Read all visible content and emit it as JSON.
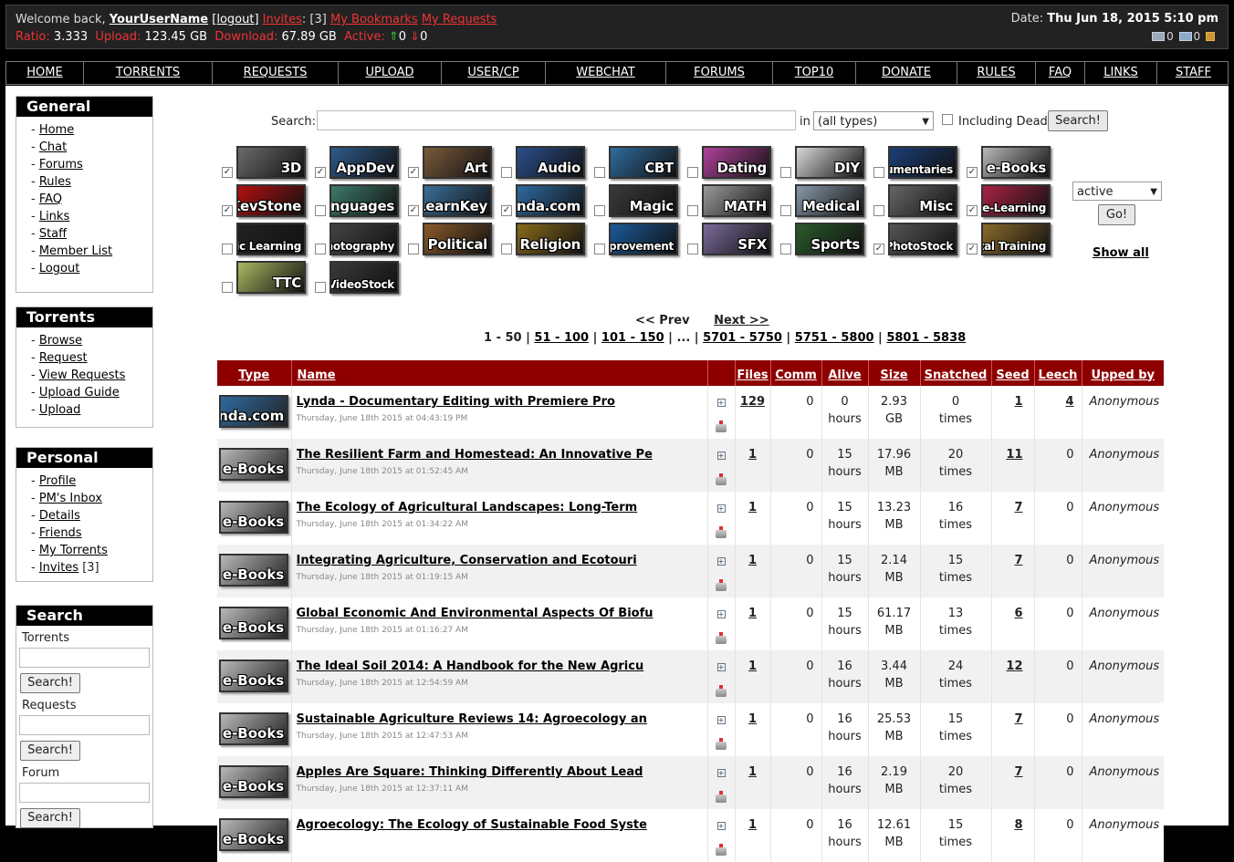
{
  "status": {
    "welcome": "Welcome back,",
    "username": "YourUserName",
    "logout": "[logout]",
    "invites_label": "Invites",
    "invites_count": ": [3]",
    "bookmarks": "My Bookmarks",
    "requests": "My Requests",
    "ratio_label": "Ratio:",
    "ratio": "3.333",
    "upload_label": "Upload:",
    "upload": "123.45 GB",
    "download_label": "Download:",
    "download": "67.89 GB",
    "active_label": "Active:",
    "active_up": "0",
    "active_down": "0",
    "date_label": "Date:",
    "date": "Thu Jun 18, 2015 5:10 pm",
    "msg1": "0",
    "msg2": "0"
  },
  "nav": [
    "HOME",
    "TORRENTS",
    "REQUESTS",
    "UPLOAD",
    "USER/CP",
    "WEBCHAT",
    "FORUMS",
    "TOP10",
    "DONATE",
    "RULES",
    "FAQ",
    "LINKS",
    "STAFF"
  ],
  "sidebar": {
    "general": {
      "title": "General",
      "items": [
        "Home",
        "Chat",
        "Forums",
        "Rules",
        "FAQ",
        "Links",
        "Staff",
        "Member List",
        "Logout"
      ]
    },
    "torrents": {
      "title": "Torrents",
      "items": [
        "Browse",
        "Request",
        "View Requests",
        "Upload Guide",
        "Upload"
      ]
    },
    "personal": {
      "title": "Personal",
      "items": [
        "Profile",
        "PM's Inbox",
        "Details",
        "Friends",
        "My Torrents",
        "Invites"
      ],
      "invites_count": "[3]"
    },
    "search": {
      "title": "Search",
      "torrents": "Torrents",
      "requests": "Requests",
      "forum": "Forum",
      "button": "Search!"
    }
  },
  "search": {
    "label": "Search:",
    "in": "in",
    "type": "(all types)",
    "including_dead": "Including Dead",
    "button": "Search!"
  },
  "categories": [
    {
      "name": "3D",
      "checked": true,
      "color": "#6b6b6b"
    },
    {
      "name": "AppDev",
      "checked": true,
      "color": "#2e5b8a"
    },
    {
      "name": "Art",
      "checked": true,
      "color": "#7a5a3a"
    },
    {
      "name": "Audio",
      "checked": false,
      "color": "#2b4e8c"
    },
    {
      "name": "CBT",
      "checked": false,
      "color": "#2f6c9e"
    },
    {
      "name": "Dating",
      "checked": false,
      "color": "#b0429a"
    },
    {
      "name": "DIY",
      "checked": false,
      "color": "#d8d8d8"
    },
    {
      "name": "Documentaries",
      "checked": false,
      "color": "#1c3f78"
    },
    {
      "name": "e-Books",
      "checked": true,
      "color": "#b8b8b8"
    },
    {
      "name": "KevStone",
      "checked": true,
      "color": "#b01010"
    },
    {
      "name": "Languages",
      "checked": false,
      "color": "#3c7a6a"
    },
    {
      "name": "LearnKey",
      "checked": true,
      "color": "#3a6e98"
    },
    {
      "name": "Lynda.com",
      "checked": true,
      "color": "#2f6aa0"
    },
    {
      "name": "Magic",
      "checked": false,
      "color": "#3a3a3a"
    },
    {
      "name": "MATH",
      "checked": false,
      "color": "#9a9a9a"
    },
    {
      "name": "Medical",
      "checked": false,
      "color": "#8899aa"
    },
    {
      "name": "Misc",
      "checked": false,
      "color": "#666666"
    },
    {
      "name": "e-Learning",
      "checked": true,
      "color": "#aa2244"
    },
    {
      "name": "Music Learning",
      "checked": false,
      "color": "#222222"
    },
    {
      "name": "Photography",
      "checked": false,
      "color": "#444444"
    },
    {
      "name": "Political",
      "checked": false,
      "color": "#8a5a2a"
    },
    {
      "name": "Religion",
      "checked": false,
      "color": "#8a6a1a"
    },
    {
      "name": "Self Improvement",
      "checked": false,
      "color": "#1a5a9a"
    },
    {
      "name": "SFX",
      "checked": false,
      "color": "#7a6a9a"
    },
    {
      "name": "Sports",
      "checked": false,
      "color": "#2a5a2a"
    },
    {
      "name": "PhotoStock",
      "checked": true,
      "color": "#555555"
    },
    {
      "name": "Total Training",
      "checked": true,
      "color": "#8a6a2a"
    },
    {
      "name": "TTC",
      "checked": false,
      "color": "#a8b860"
    },
    {
      "name": "VideoStock",
      "checked": false,
      "color": "#3a3a3a"
    }
  ],
  "filter": {
    "state": "active",
    "go": "Go!",
    "show_all": "Show all"
  },
  "pager": {
    "prev": "<< Prev",
    "next": "Next >>",
    "current": "1 - 50",
    "links": [
      "51 - 100",
      "101 - 150",
      "5701 - 5750",
      "5751 - 5800",
      "5801 - 5838"
    ],
    "ellipsis": "..."
  },
  "table": {
    "headers": [
      "Type",
      "Name",
      "",
      "Files",
      "Comm",
      "Alive",
      "Size",
      "Snatched",
      "Seed",
      "Leech",
      "Upped by"
    ],
    "rows": [
      {
        "type": "Lynda.com",
        "name": "Lynda - Documentary Editing with Premiere Pro",
        "date": "Thursday, June 18th 2015 at 04:43:19 PM",
        "files": "129",
        "comm": "0",
        "alive1": "0",
        "alive2": "hours",
        "size1": "2.93",
        "size2": "GB",
        "snatched1": "0",
        "snatched2": "times",
        "seed": "1",
        "leech": "4",
        "upped": "Anonymous"
      },
      {
        "type": "e-Books",
        "name": "The Resilient Farm and Homestead: An Innovative Pe",
        "date": "Thursday, June 18th 2015 at 01:52:45 AM",
        "files": "1",
        "comm": "0",
        "alive1": "15",
        "alive2": "hours",
        "size1": "17.96",
        "size2": "MB",
        "snatched1": "20",
        "snatched2": "times",
        "seed": "11",
        "leech": "0",
        "upped": "Anonymous"
      },
      {
        "type": "e-Books",
        "name": "The Ecology of Agricultural Landscapes: Long-Term",
        "date": "Thursday, June 18th 2015 at 01:34:22 AM",
        "files": "1",
        "comm": "0",
        "alive1": "15",
        "alive2": "hours",
        "size1": "13.23",
        "size2": "MB",
        "snatched1": "16",
        "snatched2": "times",
        "seed": "7",
        "leech": "0",
        "upped": "Anonymous"
      },
      {
        "type": "e-Books",
        "name": "Integrating Agriculture, Conservation and Ecotouri",
        "date": "Thursday, June 18th 2015 at 01:19:15 AM",
        "files": "1",
        "comm": "0",
        "alive1": "15",
        "alive2": "hours",
        "size1": "2.14",
        "size2": "MB",
        "snatched1": "15",
        "snatched2": "times",
        "seed": "7",
        "leech": "0",
        "upped": "Anonymous"
      },
      {
        "type": "e-Books",
        "name": "Global Economic And Environmental Aspects Of Biofu",
        "date": "Thursday, June 18th 2015 at 01:16:27 AM",
        "files": "1",
        "comm": "0",
        "alive1": "15",
        "alive2": "hours",
        "size1": "61.17",
        "size2": "MB",
        "snatched1": "13",
        "snatched2": "times",
        "seed": "6",
        "leech": "0",
        "upped": "Anonymous"
      },
      {
        "type": "e-Books",
        "name": "The Ideal Soil 2014: A Handbook for the New Agricu",
        "date": "Thursday, June 18th 2015 at 12:54:59 AM",
        "files": "1",
        "comm": "0",
        "alive1": "16",
        "alive2": "hours",
        "size1": "3.44",
        "size2": "MB",
        "snatched1": "24",
        "snatched2": "times",
        "seed": "12",
        "leech": "0",
        "upped": "Anonymous"
      },
      {
        "type": "e-Books",
        "name": "Sustainable Agriculture Reviews 14: Agroecology an",
        "date": "Thursday, June 18th 2015 at 12:47:53 AM",
        "files": "1",
        "comm": "0",
        "alive1": "16",
        "alive2": "hours",
        "size1": "25.53",
        "size2": "MB",
        "snatched1": "15",
        "snatched2": "times",
        "seed": "7",
        "leech": "0",
        "upped": "Anonymous"
      },
      {
        "type": "e-Books",
        "name": "Apples Are Square: Thinking Differently About Lead",
        "date": "Thursday, June 18th 2015 at 12:37:11 AM",
        "files": "1",
        "comm": "0",
        "alive1": "16",
        "alive2": "hours",
        "size1": "2.19",
        "size2": "MB",
        "snatched1": "20",
        "snatched2": "times",
        "seed": "7",
        "leech": "0",
        "upped": "Anonymous"
      },
      {
        "type": "e-Books",
        "name": "Agroecology: The Ecology of Sustainable Food Syste",
        "date": "",
        "files": "1",
        "comm": "0",
        "alive1": "16",
        "alive2": "hours",
        "size1": "12.61",
        "size2": "MB",
        "snatched1": "15",
        "snatched2": "times",
        "seed": "8",
        "leech": "0",
        "upped": "Anonymous"
      }
    ]
  }
}
